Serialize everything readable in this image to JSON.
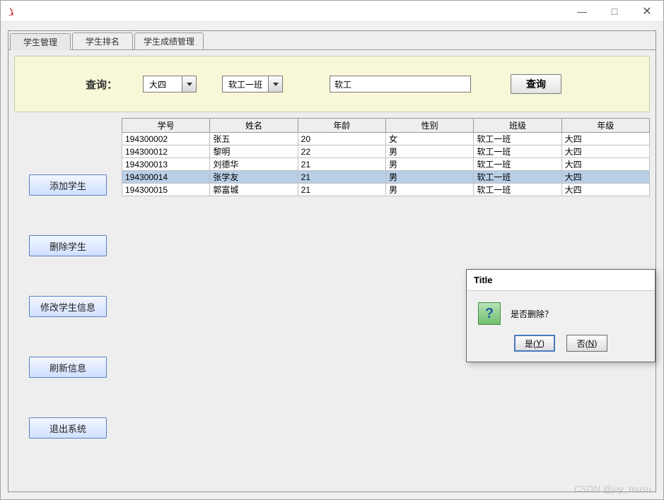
{
  "window": {
    "title": "",
    "min": "—",
    "max": "□",
    "close": "✕"
  },
  "tabs": [
    {
      "label": "学生管理",
      "active": true
    },
    {
      "label": "学生排名",
      "active": false
    },
    {
      "label": "学生成绩管理",
      "active": false
    }
  ],
  "search": {
    "label": "查询：",
    "grade_value": "大四",
    "class_value": "软工一班",
    "keyword_value": "软工",
    "button_label": "查询"
  },
  "sidebar": {
    "add_label": "添加学生",
    "delete_label": "删除学生",
    "edit_label": "修改学生信息",
    "refresh_label": "刷新信息",
    "exit_label": "退出系统"
  },
  "table": {
    "headers": [
      "学号",
      "姓名",
      "年龄",
      "性别",
      "班级",
      "年级"
    ],
    "rows": [
      {
        "cols": [
          "194300002",
          "张五",
          "20",
          "女",
          "软工一班",
          "大四"
        ],
        "selected": false
      },
      {
        "cols": [
          "194300012",
          "黎明",
          "22",
          "男",
          "软工一班",
          "大四"
        ],
        "selected": false
      },
      {
        "cols": [
          "194300013",
          "刘德华",
          "21",
          "男",
          "软工一班",
          "大四"
        ],
        "selected": false
      },
      {
        "cols": [
          "194300014",
          "张学友",
          "21",
          "男",
          "软工一班",
          "大四"
        ],
        "selected": true
      },
      {
        "cols": [
          "194300015",
          "郭富城",
          "21",
          "男",
          "软工一班",
          "大四"
        ],
        "selected": false
      }
    ]
  },
  "dialog": {
    "title": "Title",
    "message": "是否删除？",
    "yes_prefix": "是(",
    "yes_key": "Y",
    "yes_suffix": ")",
    "no_prefix": "否(",
    "no_key": "N",
    "no_suffix": ")"
  },
  "watermark": "CSDN @jay_musu"
}
